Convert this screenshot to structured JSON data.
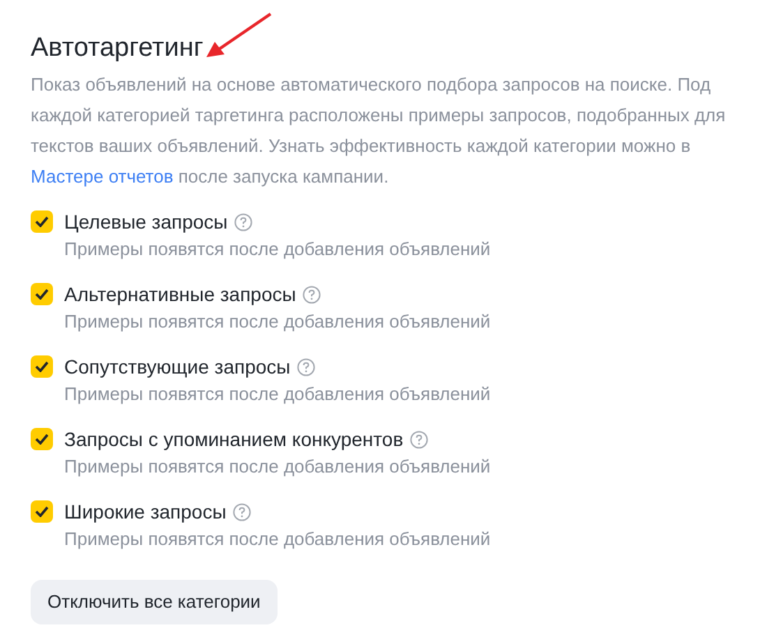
{
  "title": "Автотаргетинг",
  "description": {
    "text": "Показ объявлений на основе автоматического подбора запросов на поиске. Под каждой категорией таргетинга расположены примеры запросов, подобранных для текстов ваших объявлений. Узнать эффективность каждой категории можно в",
    "link": "Мастере отчетов",
    "after": "после запуска кампании."
  },
  "categories": [
    {
      "label": "Целевые запросы",
      "checked": true,
      "hint": "Примеры появятся после добавления объявлений"
    },
    {
      "label": "Альтернативные запросы",
      "checked": true,
      "hint": "Примеры появятся после добавления объявлений"
    },
    {
      "label": "Сопутствующие запросы",
      "checked": true,
      "hint": "Примеры появятся после добавления объявлений"
    },
    {
      "label": "Запросы с упоминанием конкурентов",
      "checked": true,
      "hint": "Примеры появятся после добавления объявлений"
    },
    {
      "label": "Широкие запросы",
      "checked": true,
      "hint": "Примеры появятся после добавления объявлений"
    }
  ],
  "button": "Отключить все категории"
}
